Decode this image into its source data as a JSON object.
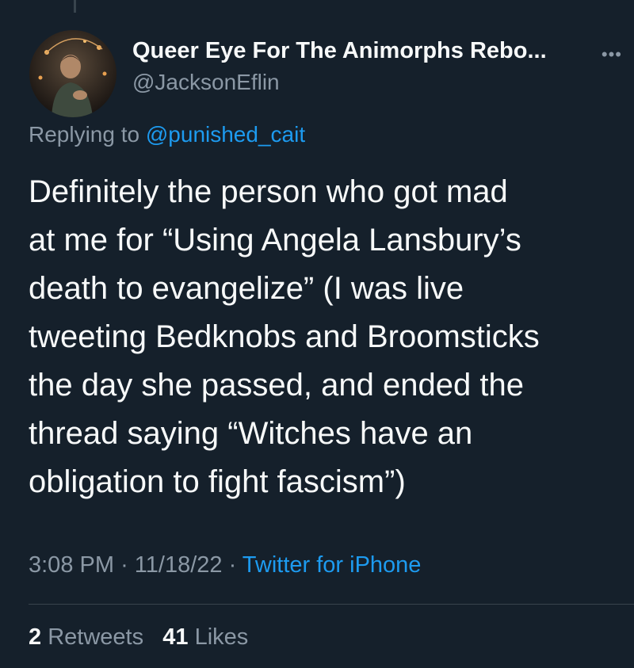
{
  "tweet": {
    "author": {
      "display_name": "Queer Eye For The Animorphs Rebo...",
      "handle": "@JacksonEflin",
      "avatar_icon": "profile-photo"
    },
    "more_icon": "more-options-icon",
    "reply_context": {
      "prefix": "Replying to",
      "mention": "@punished_cait"
    },
    "text_lines": [
      "Definitely the person who got mad",
      "at me for “Using Angela Lansbury’s",
      "death to evangelize” (I was live",
      "tweeting Bedknobs and Broomsticks",
      "the day she passed, and ended the",
      "thread saying “Witches have an",
      "obligation to fight fascism”)"
    ],
    "time": "3:08 PM",
    "date": "11/18/22",
    "source": "Twitter for iPhone",
    "stats": {
      "retweets_count": "2",
      "retweets_label": "Retweets",
      "likes_count": "41",
      "likes_label": "Likes"
    }
  },
  "colors": {
    "background": "#15202b",
    "text_primary": "#f7f9f9",
    "text_secondary": "#8b98a5",
    "accent": "#1d9bf0",
    "divider": "#38444d"
  }
}
